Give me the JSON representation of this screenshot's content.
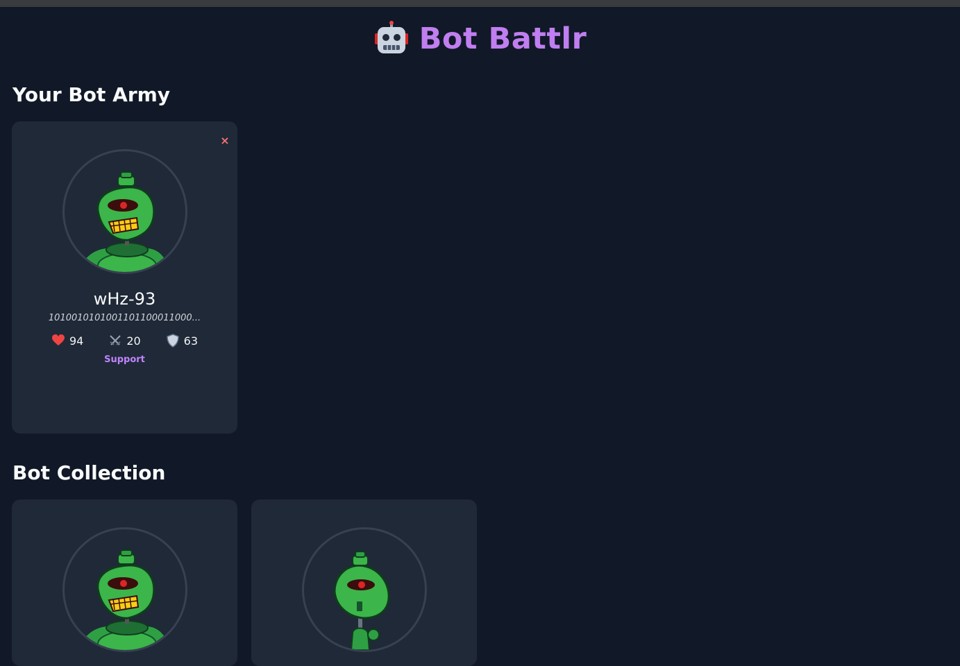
{
  "app": {
    "title": "Bot Battlr",
    "logo_icon": "robot-icon"
  },
  "army": {
    "heading": "Your Bot Army",
    "bots": [
      {
        "name": "wHz-93",
        "catchphrase": "1010010101001101100011000...",
        "health": "94",
        "damage": "20",
        "armor": "63",
        "bot_class": "Support",
        "remove_label": "×",
        "avatar_variant": "grin"
      }
    ]
  },
  "collection": {
    "heading": "Bot Collection",
    "bots": [
      {
        "avatar_variant": "grin"
      },
      {
        "avatar_variant": "slim"
      }
    ]
  },
  "colors": {
    "background": "#111827",
    "card": "#1f2937",
    "accent": "#c07ef0",
    "class_label": "#c084fc",
    "remove": "#f87171"
  }
}
